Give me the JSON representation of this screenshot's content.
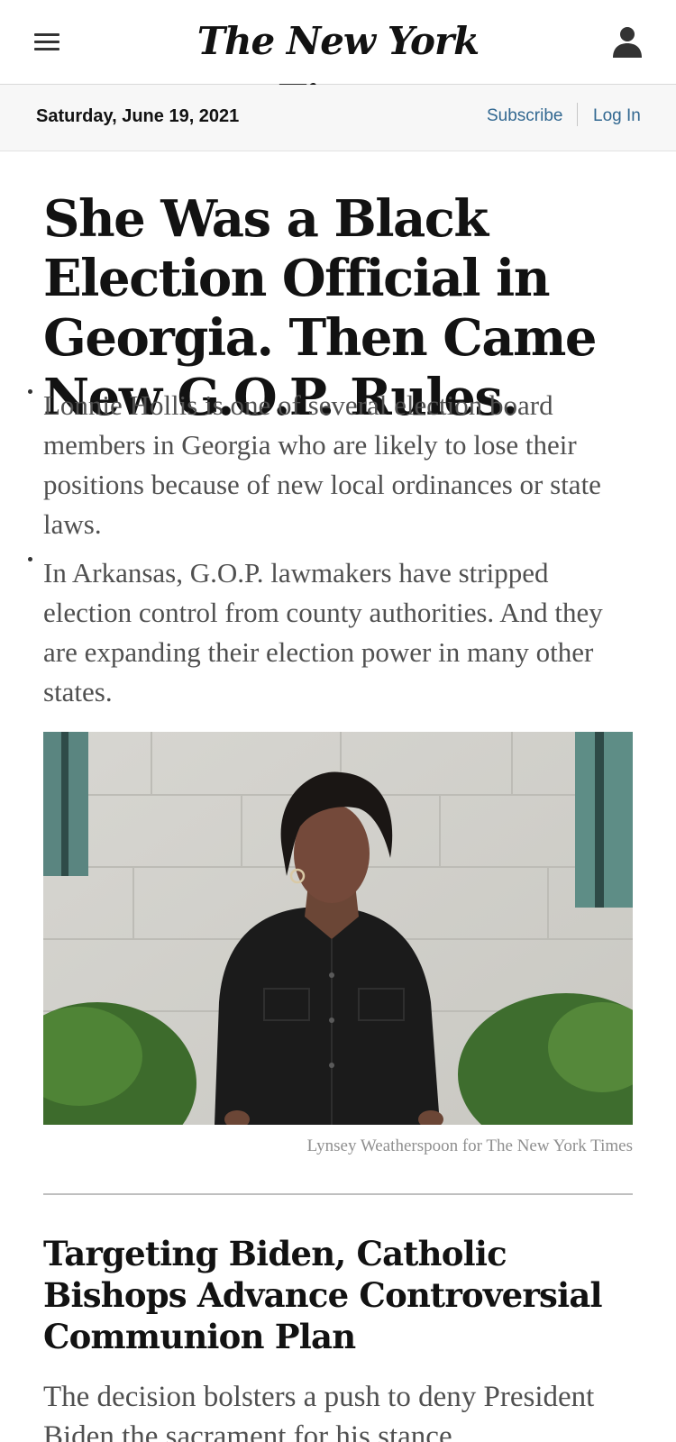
{
  "header": {
    "logo_text": "The New York Times",
    "menu_icon": "hamburger-menu-icon",
    "user_icon": "user-account-icon"
  },
  "datebar": {
    "date": "Saturday, June 19, 2021",
    "subscribe_label": "Subscribe",
    "login_label": "Log In"
  },
  "lead_story": {
    "headline": "She Was a Black Election Official in Georgia. Then Came New G.O.P. Rules.",
    "bullets": [
      "Lonnie Hollis is one of several election board members in Georgia who are likely to lose their positions because of new local ordinances or state laws.",
      "In Arkansas, G.O.P. lawmakers have stripped election control from county authorities. And they are expanding their election power in many other states."
    ],
    "photo_credit": "Lynsey Weatherspoon for The New York Times"
  },
  "second_story": {
    "headline": "Targeting Biden, Catholic Bishops Advance Controversial Communion Plan",
    "summary": "The decision bolsters a push to deny President Biden the sacrament for his stance"
  },
  "colors": {
    "link": "#326891",
    "text": "#121212",
    "summary": "#505050",
    "datebar_bg": "#f7f7f7"
  }
}
